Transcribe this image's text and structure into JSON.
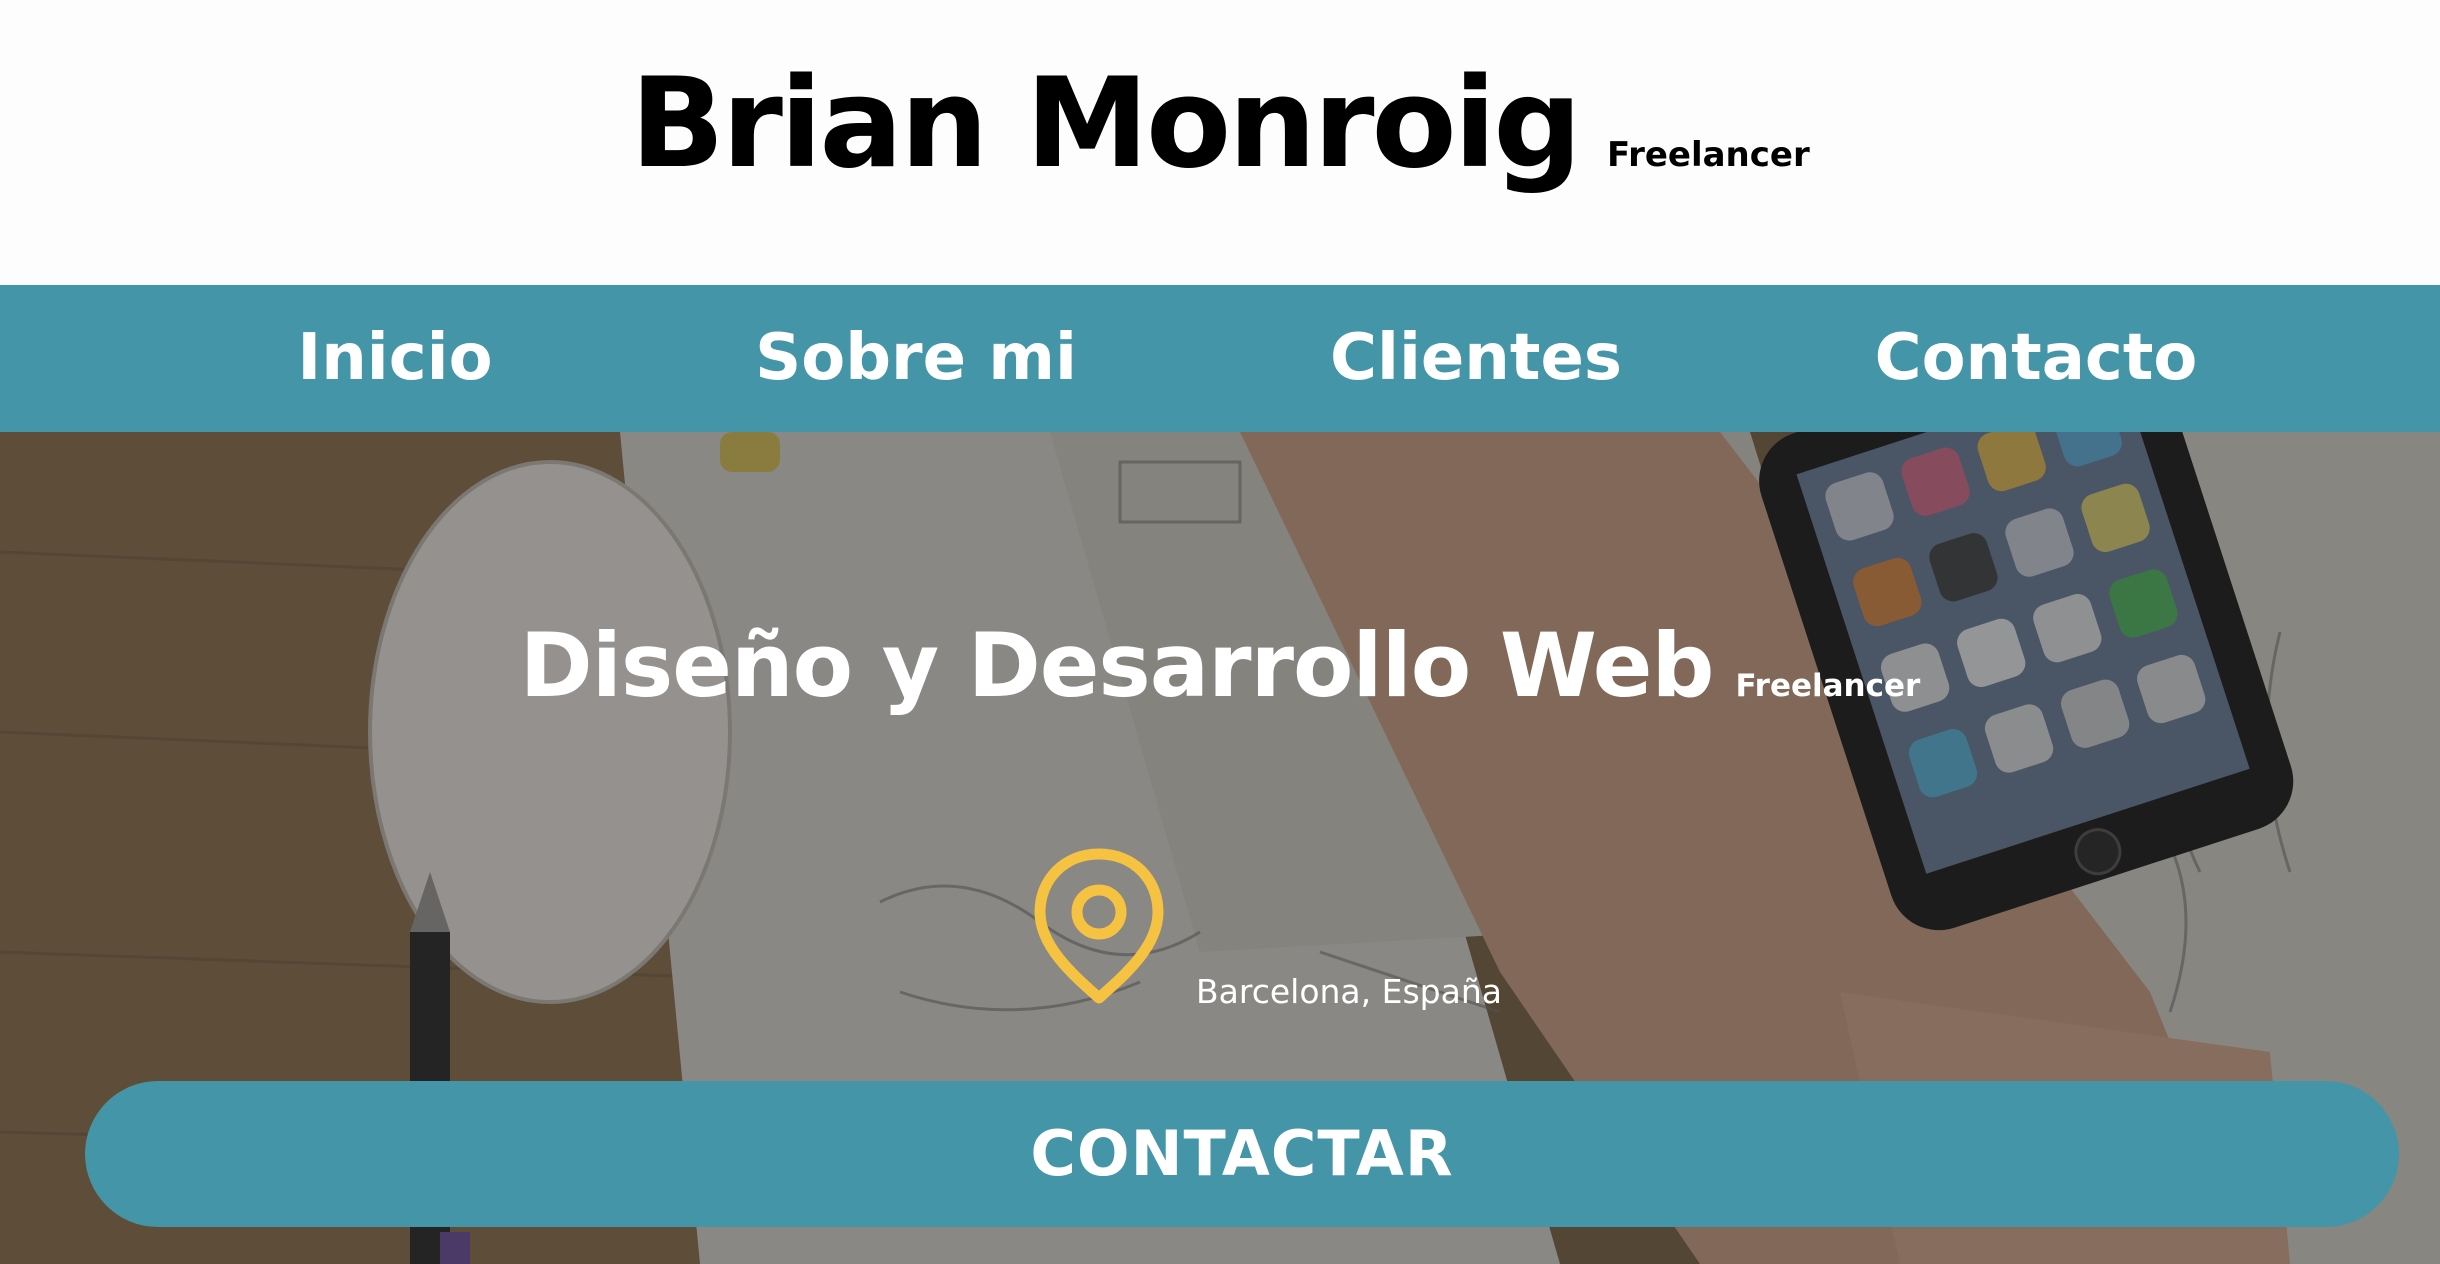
{
  "header": {
    "name": "Brian Monroig",
    "tagline": "Freelancer"
  },
  "nav": {
    "items": [
      {
        "label": "Inicio"
      },
      {
        "label": "Sobre mi"
      },
      {
        "label": "Clientes"
      },
      {
        "label": "Contacto"
      }
    ]
  },
  "hero": {
    "title": "Diseño y Desarrollo Web",
    "title_tag": "Freelancer",
    "location_icon": "map-pin-icon",
    "location": "Barcelona, España",
    "cta_label": "CONTACTAR"
  },
  "colors": {
    "accent": "#4495a7",
    "pin": "#f5c242",
    "header_bg": "#fdfdfd"
  }
}
